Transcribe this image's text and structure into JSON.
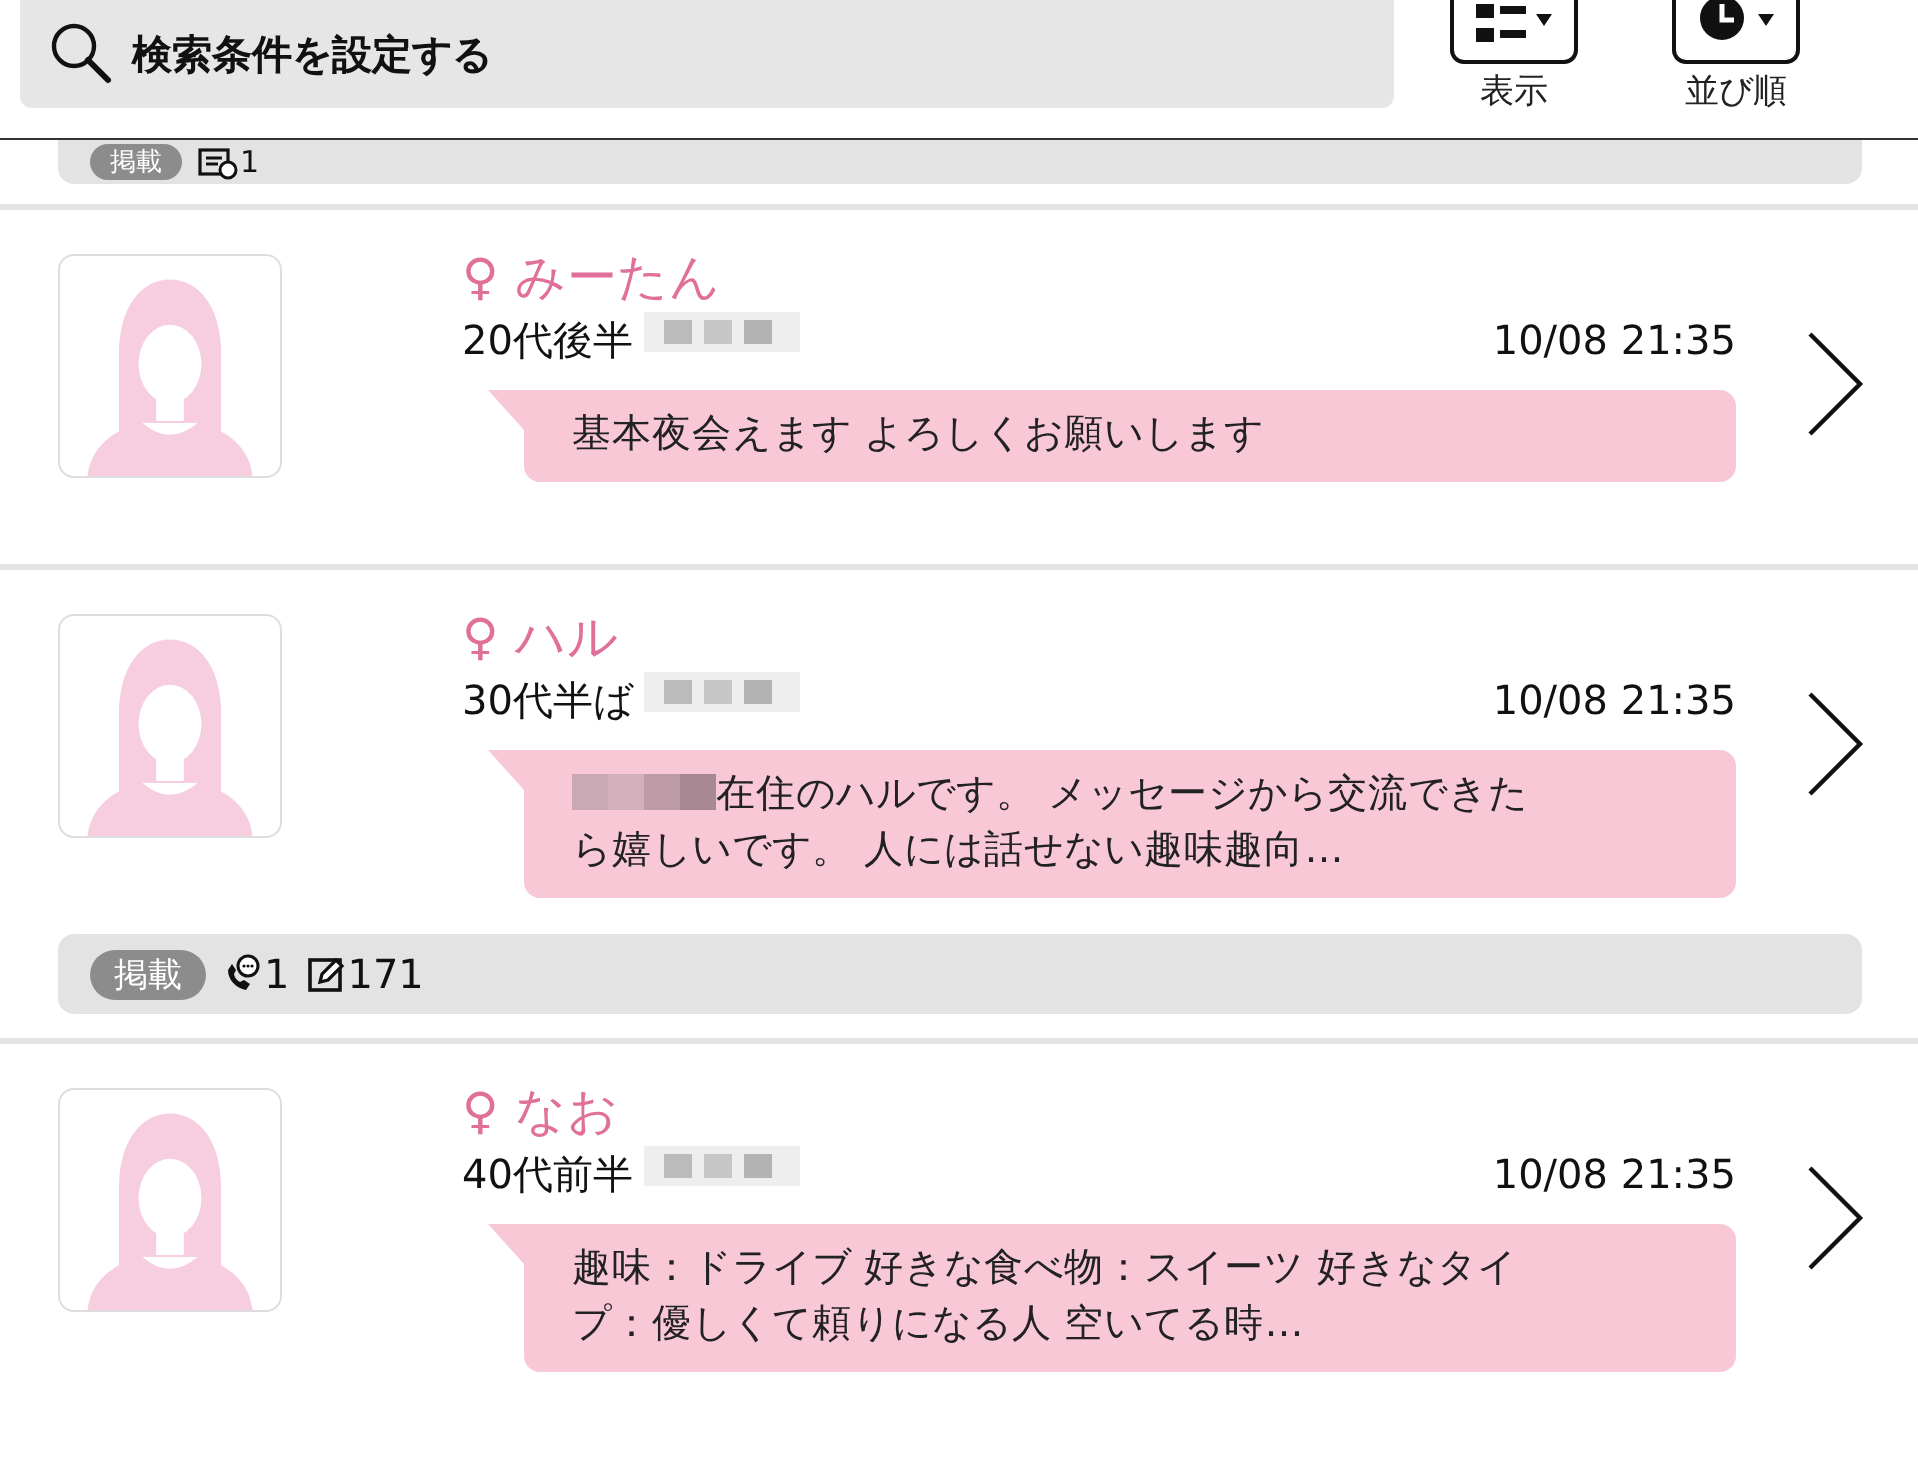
{
  "search": {
    "label": "検索条件を設定する"
  },
  "toolbar": [
    {
      "kind": "view",
      "label": "表示"
    },
    {
      "kind": "sort",
      "label": "並び順"
    }
  ],
  "top_stats": {
    "badge": "掲載",
    "stats": [
      {
        "kind": "memo",
        "count": "1"
      }
    ]
  },
  "profiles": [
    {
      "name": "♀ みーたん",
      "age": "20代後半",
      "location_masked": true,
      "time": "10/08 21:35",
      "message_masked_prefix": false,
      "message": "基本夜会えます よろしくお願いします"
    },
    {
      "name": "♀ ハル",
      "age": "30代半ば",
      "location_masked": true,
      "time": "10/08 21:35",
      "message_masked_prefix": true,
      "message": "在住のハルです。 メッセージから交流できたら嬉しいです。 人には話せない趣味趣向…",
      "stats": {
        "badge": "掲載",
        "stats": [
          {
            "kind": "call",
            "count": "1"
          },
          {
            "kind": "edit",
            "count": "171"
          }
        ]
      }
    },
    {
      "name": "♀ なお",
      "age": "40代前半",
      "location_masked": true,
      "time": "10/08 21:35",
      "message_masked_prefix": false,
      "message": "趣味：ドライブ 好きな食べ物：スイーツ 好きなタイプ：優しくて頼りになる人 空いてる時…"
    }
  ]
}
